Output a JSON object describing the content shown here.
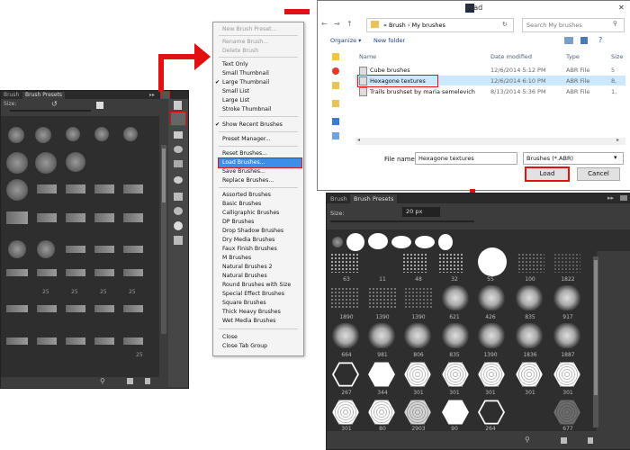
{
  "left_panel": {
    "tabs": [
      "Brush",
      "Brush Presets"
    ],
    "size_label": "Size:",
    "numbers": [
      "25",
      "25",
      "25",
      "25",
      "25"
    ]
  },
  "menu": {
    "items": [
      {
        "label": "New Brush Preset...",
        "disabled": true
      },
      {
        "label": "Rename Brush...",
        "disabled": true
      },
      {
        "label": "Delete Brush",
        "disabled": true
      },
      {
        "label": "Text Only"
      },
      {
        "label": "Small Thumbnail"
      },
      {
        "label": "Large Thumbnail",
        "checked": true
      },
      {
        "label": "Small List"
      },
      {
        "label": "Large List"
      },
      {
        "label": "Stroke Thumbnail"
      },
      {
        "label": "Show Recent Brushes",
        "checked": true
      },
      {
        "label": "Preset Manager..."
      },
      {
        "label": "Reset Brushes..."
      },
      {
        "label": "Load Brushes...",
        "highlighted": true
      },
      {
        "label": "Save Brushes..."
      },
      {
        "label": "Replace Brushes..."
      },
      {
        "label": "Assorted Brushes"
      },
      {
        "label": "Basic Brushes"
      },
      {
        "label": "Calligraphic Brushes"
      },
      {
        "label": "DP Brushes"
      },
      {
        "label": "Drop Shadow Brushes"
      },
      {
        "label": "Dry Media Brushes"
      },
      {
        "label": "Faux Finish Brushes"
      },
      {
        "label": "M Brushes"
      },
      {
        "label": "Natural Brushes 2"
      },
      {
        "label": "Natural Brushes"
      },
      {
        "label": "Round Brushes with Size"
      },
      {
        "label": "Special Effect Brushes"
      },
      {
        "label": "Square Brushes"
      },
      {
        "label": "Thick Heavy Brushes"
      },
      {
        "label": "Wet Media Brushes"
      },
      {
        "label": "Close"
      },
      {
        "label": "Close Tab Group"
      }
    ]
  },
  "dialog": {
    "title": "Load",
    "app_icon": "Ps",
    "breadcrumb": "« Brush › My brushes",
    "search_placeholder": "Search My brushes",
    "organize": "Organize ▾",
    "new_folder": "New folder",
    "columns": [
      "Name",
      "Date modified",
      "Type",
      "Size"
    ],
    "files": [
      {
        "name": "Cube brushes",
        "date": "12/6/2014 5:12 PM",
        "type": "ABR File",
        "size": "5"
      },
      {
        "name": "Hexagone textures",
        "date": "12/6/2014 6:10 PM",
        "type": "ABR File",
        "size": "8,"
      },
      {
        "name": "Trails brushset by maria semelevich",
        "date": "8/13/2014 5:36 PM",
        "type": "ABR File",
        "size": "1,"
      }
    ],
    "file_name_label": "File name:",
    "file_name_value": "Hexagone textures",
    "filter_value": "Brushes (*.ABR)",
    "load_button": "Load",
    "cancel_button": "Cancel"
  },
  "right_panel": {
    "tabs": [
      "Brush",
      "Brush Presets"
    ],
    "size_label": "Size:",
    "size_value": "20 px",
    "rows": [
      [
        "63",
        "11",
        "48",
        "32",
        "55",
        "100",
        "1822"
      ],
      [
        "1890",
        "1390",
        "1390",
        "621",
        "426",
        "835",
        "917"
      ],
      [
        "664",
        "981",
        "806",
        "835",
        "1390",
        "1836",
        "1887"
      ],
      [
        "267",
        "344",
        "301",
        "301",
        "301",
        "301",
        "301"
      ],
      [
        "301",
        "80",
        "2903",
        "90",
        "264",
        "",
        "677"
      ]
    ]
  },
  "colors": {
    "accent_red": "#e21010",
    "menu_highlight": "#3d8ee6",
    "panel_bg": "#3c3c3c"
  }
}
